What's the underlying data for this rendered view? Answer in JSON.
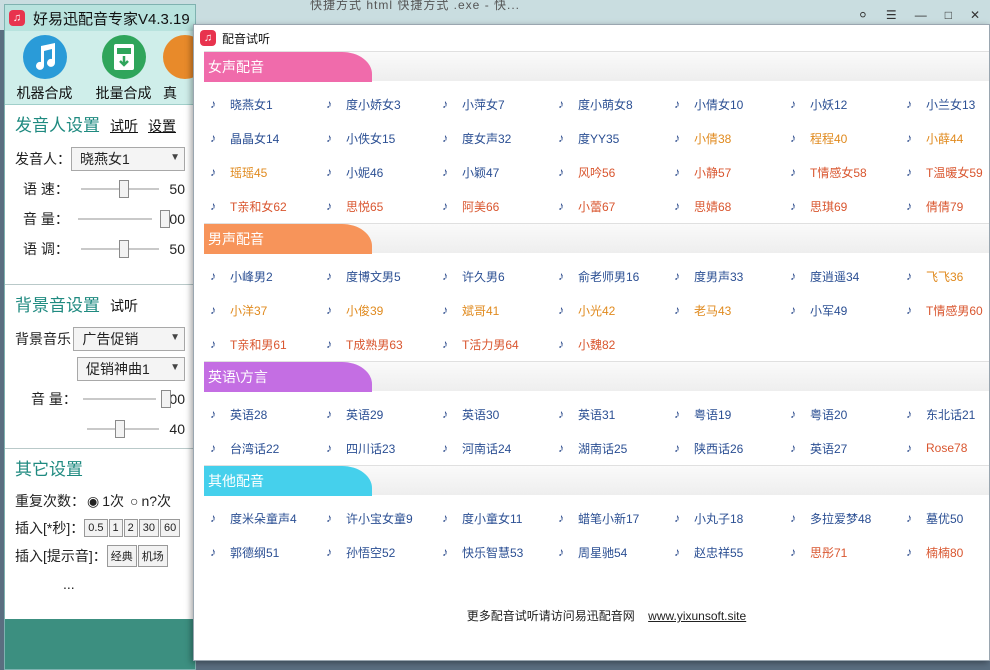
{
  "background": {
    "ghost_text": "快捷方式      html        快捷方式  .exe - 快..."
  },
  "main_window": {
    "title": "好易迅配音专家V4.3.19",
    "toolbar": [
      {
        "label": "机器合成",
        "icon": "music-note-icon",
        "color": "#2a9bd8"
      },
      {
        "label": "批量合成",
        "icon": "mp3-download-icon",
        "color": "#2fa55b"
      },
      {
        "label": "真",
        "icon": "real-voice-icon",
        "color": "#e88a2a"
      }
    ],
    "speaker": {
      "title": "发音人设置",
      "listen_link": "试听",
      "settings_link": "设置",
      "speaker_label": "发音人：",
      "speaker_value": "晓燕女1",
      "speed_label": "语 速：",
      "speed_value": "50",
      "speed_level": 0.5,
      "volume_label": "音 量：",
      "volume_value": "100",
      "volume_level": 1.0,
      "tone_label": "语 调：",
      "tone_value": "50",
      "tone_level": 0.5
    },
    "bgm": {
      "title": "背景音设置",
      "listen_link": "试听",
      "music_label": "背景音乐",
      "music_value": "广告促销",
      "track_value": "促销神曲1",
      "volume_label": "音 量：",
      "volume_value": "100",
      "volume_level": 1.0,
      "second_value": "40",
      "second_level": 0.4
    },
    "other": {
      "title": "其它设置",
      "repeat_label": "重复次数：",
      "repeat_opt1": "1次",
      "repeat_opt2": "n?次",
      "insert_sec_label": "插入[*秒]：",
      "insert_sec_buttons": [
        "0.5",
        "1",
        "2",
        "30",
        "60"
      ],
      "insert_tip_label": "插入[提示音]：",
      "insert_tip_buttons": [
        "经典",
        "机场"
      ],
      "ellipsis": "..."
    }
  },
  "popup": {
    "title": "配音试听",
    "categories": [
      {
        "name": "女声配音",
        "color": "#f06bab",
        "items": [
          {
            "n": "晓燕女1",
            "c": "blue"
          },
          {
            "n": "度小娇女3",
            "c": "blue"
          },
          {
            "n": "小萍女7",
            "c": "blue"
          },
          {
            "n": "度小萌女8",
            "c": "blue"
          },
          {
            "n": "小倩女10",
            "c": "blue"
          },
          {
            "n": "小妖12",
            "c": "blue"
          },
          {
            "n": "小兰女13",
            "c": "blue"
          },
          {
            "n": "晶晶女14",
            "c": "blue"
          },
          {
            "n": "小佚女15",
            "c": "blue"
          },
          {
            "n": "度女声32",
            "c": "blue"
          },
          {
            "n": "度YY35",
            "c": "blue"
          },
          {
            "n": "小倩38",
            "c": "orange"
          },
          {
            "n": "程程40",
            "c": "orange"
          },
          {
            "n": "小薛44",
            "c": "orange"
          },
          {
            "n": "瑶瑶45",
            "c": "orange"
          },
          {
            "n": "小妮46",
            "c": "blue"
          },
          {
            "n": "小颖47",
            "c": "blue"
          },
          {
            "n": "风吟56",
            "c": "red"
          },
          {
            "n": "小静57",
            "c": "red"
          },
          {
            "n": "T情感女58",
            "c": "red"
          },
          {
            "n": "T温暖女59",
            "c": "red"
          },
          {
            "n": "T亲和女62",
            "c": "red"
          },
          {
            "n": "思悦65",
            "c": "red"
          },
          {
            "n": "阿美66",
            "c": "red"
          },
          {
            "n": "小蕾67",
            "c": "red"
          },
          {
            "n": "思婧68",
            "c": "red"
          },
          {
            "n": "思琪69",
            "c": "red"
          },
          {
            "n": "倩倩79",
            "c": "red"
          }
        ]
      },
      {
        "name": "男声配音",
        "color": "#f7945a",
        "items": [
          {
            "n": "小峰男2",
            "c": "blue"
          },
          {
            "n": "度博文男5",
            "c": "blue"
          },
          {
            "n": "许久男6",
            "c": "blue"
          },
          {
            "n": "俞老师男16",
            "c": "blue"
          },
          {
            "n": "度男声33",
            "c": "blue"
          },
          {
            "n": "度逍遥34",
            "c": "blue"
          },
          {
            "n": "飞飞36",
            "c": "orange"
          },
          {
            "n": "小洋37",
            "c": "orange"
          },
          {
            "n": "小俊39",
            "c": "orange"
          },
          {
            "n": "斌哥41",
            "c": "orange"
          },
          {
            "n": "小光42",
            "c": "orange"
          },
          {
            "n": "老马43",
            "c": "orange"
          },
          {
            "n": "小军49",
            "c": "blue"
          },
          {
            "n": "T情感男60",
            "c": "red"
          },
          {
            "n": "T亲和男61",
            "c": "red"
          },
          {
            "n": "T成熟男63",
            "c": "red"
          },
          {
            "n": "T活力男64",
            "c": "red"
          },
          {
            "n": "小魏82",
            "c": "red"
          }
        ]
      },
      {
        "name": "英语\\方言",
        "color": "#c46ee3",
        "items": [
          {
            "n": "英语28",
            "c": "blue"
          },
          {
            "n": "英语29",
            "c": "blue"
          },
          {
            "n": "英语30",
            "c": "blue"
          },
          {
            "n": "英语31",
            "c": "blue"
          },
          {
            "n": "粤语19",
            "c": "blue"
          },
          {
            "n": "粤语20",
            "c": "blue"
          },
          {
            "n": "东北话21",
            "c": "blue"
          },
          {
            "n": "台湾话22",
            "c": "blue"
          },
          {
            "n": "四川话23",
            "c": "blue"
          },
          {
            "n": "河南话24",
            "c": "blue"
          },
          {
            "n": "湖南话25",
            "c": "blue"
          },
          {
            "n": "陕西话26",
            "c": "blue"
          },
          {
            "n": "英语27",
            "c": "blue"
          },
          {
            "n": "Rose78",
            "c": "red"
          }
        ]
      },
      {
        "name": "其他配音",
        "color": "#45d0ec",
        "items": [
          {
            "n": "度米朵童声4",
            "c": "blue"
          },
          {
            "n": "许小宝女童9",
            "c": "blue"
          },
          {
            "n": "度小童女11",
            "c": "blue"
          },
          {
            "n": "蜡笔小新17",
            "c": "blue"
          },
          {
            "n": "小丸子18",
            "c": "blue"
          },
          {
            "n": "多拉爱梦48",
            "c": "blue"
          },
          {
            "n": "墓优50",
            "c": "blue"
          },
          {
            "n": "郭德纲51",
            "c": "blue"
          },
          {
            "n": "孙悟空52",
            "c": "blue"
          },
          {
            "n": "快乐智慧53",
            "c": "blue"
          },
          {
            "n": "周星驰54",
            "c": "blue"
          },
          {
            "n": "赵忠祥55",
            "c": "blue"
          },
          {
            "n": "思彤71",
            "c": "red"
          },
          {
            "n": "楠楠80",
            "c": "red"
          }
        ]
      }
    ],
    "footer_text": "更多配音试听请访问易迅配音网",
    "footer_link": "www.yixunsoft.site"
  }
}
